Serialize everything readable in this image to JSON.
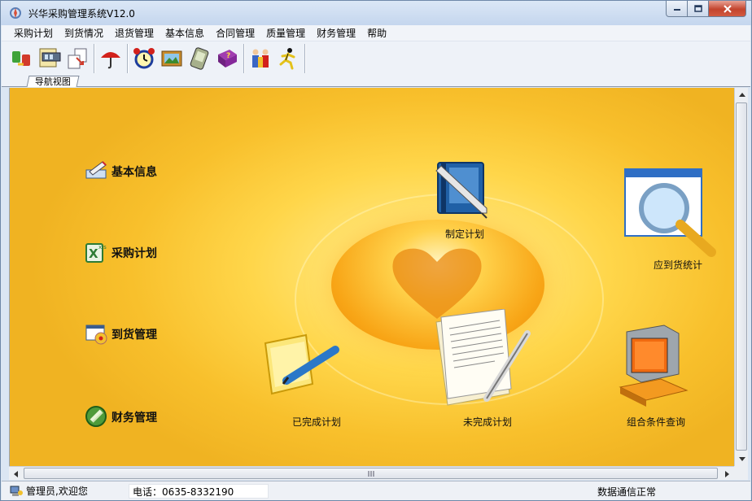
{
  "window": {
    "title": "兴华采购管理系统V12.0"
  },
  "menu": {
    "items": [
      "采购计划",
      "到货情况",
      "退货管理",
      "基本信息",
      "合同管理",
      "质量管理",
      "财务管理",
      "帮助"
    ]
  },
  "toolbar": {
    "buttons": [
      {
        "icon": "exchange-icon"
      },
      {
        "icon": "film-document-icon"
      },
      {
        "icon": "documents-arrow-icon"
      },
      {
        "icon": "umbrella-icon"
      },
      {
        "icon": "alarm-clock-icon"
      },
      {
        "icon": "picture-icon"
      },
      {
        "icon": "pda-icon"
      },
      {
        "icon": "help-book-icon"
      },
      {
        "icon": "users-icon"
      },
      {
        "icon": "running-man-icon"
      }
    ]
  },
  "tabs": {
    "nav_view": "导航视图"
  },
  "navigation": {
    "basic_info": "基本信息",
    "purchase_plan": "采购计划",
    "arrival_mgmt": "到货管理",
    "finance_mgmt": "财务管理"
  },
  "features": {
    "make_plan": "制定计划",
    "arrival_stats": "应到货统计",
    "completed_plan": "已完成计划",
    "uncompleted_plan": "未完成计划",
    "combined_query": "组合条件查询"
  },
  "statusbar": {
    "user_text": "管理员,欢迎您",
    "phone_text": "电话：0635-8332190",
    "connection_text": "数据通信正常"
  },
  "colors": {
    "accent_yellow": "#f8c02c",
    "orb_orange": "#f8a516"
  }
}
